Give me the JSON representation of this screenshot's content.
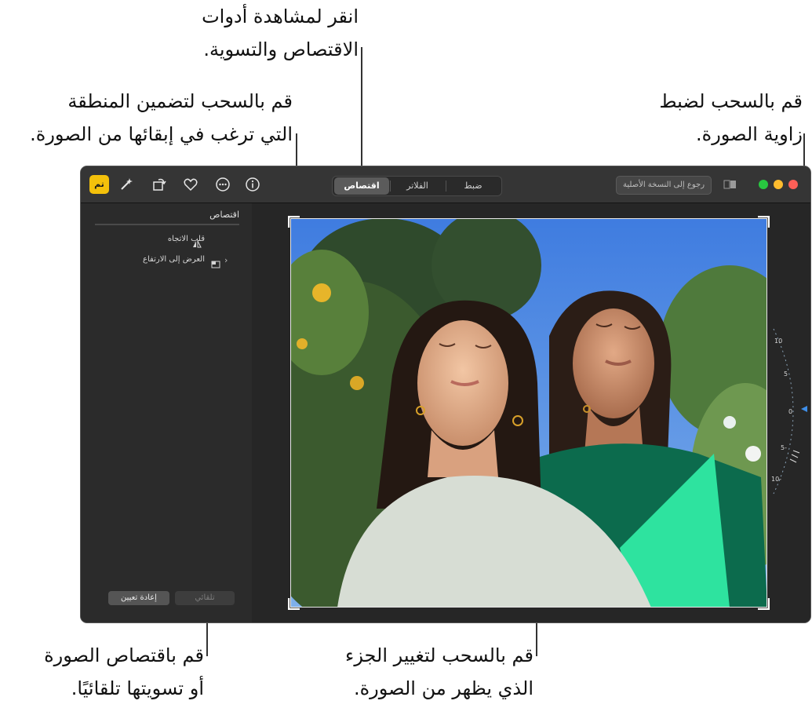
{
  "callouts": {
    "tools": {
      "line1": "انقر لمشاهدة أدوات",
      "line2": "الاقتصاص والتسوية."
    },
    "include_area": {
      "line1": "قم بالسحب لتضمين المنطقة",
      "line2": "التي ترغب في إبقائها من الصورة."
    },
    "angle": {
      "line1": "قم بالسحب لضبط",
      "line2": "زاوية الصورة."
    },
    "auto": {
      "line1": "قم باقتصاص الصورة",
      "line2": "أو تسويتها تلقائيًا."
    },
    "move": {
      "line1": "قم بالسحب لتغيير الجزء",
      "line2": "الذي يظهر من الصورة."
    }
  },
  "toolbar": {
    "done_label": "تم",
    "tabs": [
      {
        "label": "ضبط",
        "active": false
      },
      {
        "label": "الفلاتر",
        "active": false
      },
      {
        "label": "اقتصاص",
        "active": true
      }
    ],
    "revert_label": "رجوع إلى النسخة الأصلية",
    "icons": [
      "magic-wand-icon",
      "rotate-icon",
      "heart-icon",
      "more-icon",
      "info-icon"
    ],
    "traffic_colors": {
      "close": "#fe5f57",
      "minimize": "#febc2e",
      "zoom": "#28c840"
    },
    "accent": "#f4c10b"
  },
  "sidebar": {
    "title": "اقتصاص",
    "items": [
      {
        "label": "قلب الاتجاه",
        "icon": "flip-icon"
      },
      {
        "label": "العرض إلى الارتفاع",
        "icon": "aspect-ratio-icon"
      }
    ],
    "auto_label": "تلقائي",
    "reset_label": "إعادة تعيين"
  },
  "dial": {
    "labels": [
      "10",
      "5",
      "0",
      "5-",
      "10-"
    ]
  }
}
